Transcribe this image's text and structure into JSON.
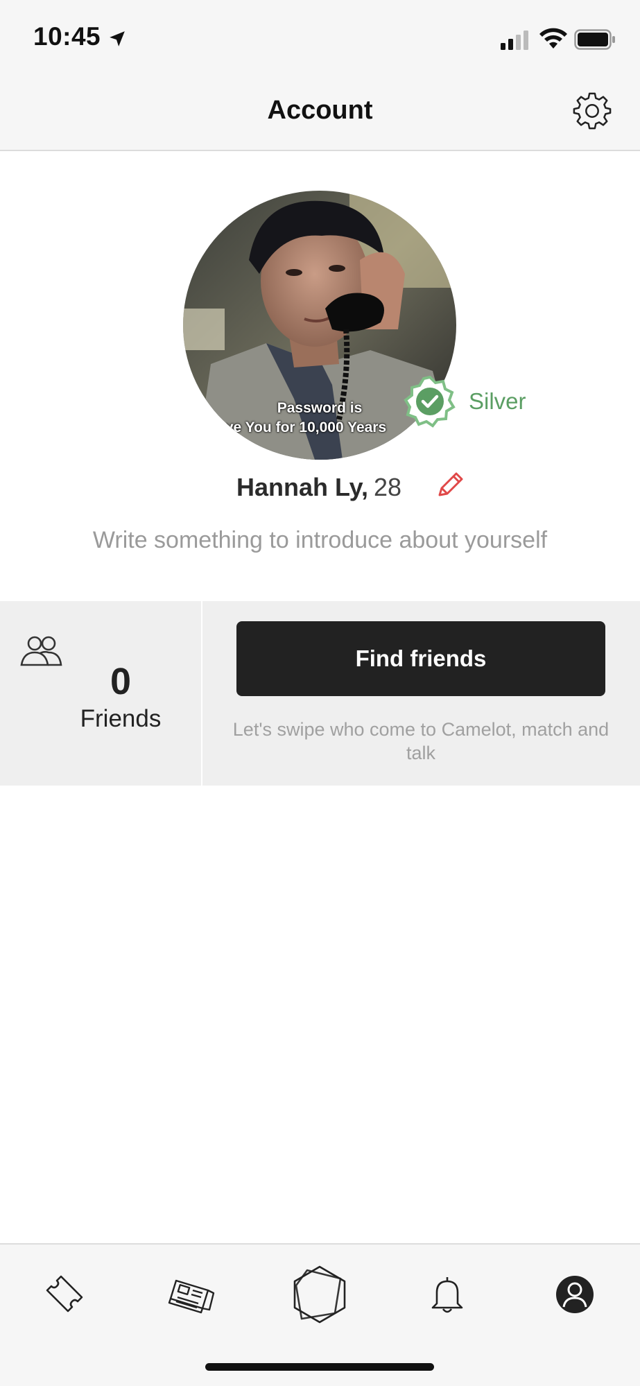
{
  "status_bar": {
    "time": "10:45",
    "icons": [
      "location-arrow-icon",
      "cellular-signal-icon",
      "wifi-icon",
      "battery-icon"
    ]
  },
  "nav": {
    "title": "Account",
    "settings_icon": "gear-icon"
  },
  "profile": {
    "avatar_caption_line1": "Password is",
    "avatar_caption_line2": "ve You for 10,000 Years",
    "badge_icon": "verified-badge-icon",
    "badge_label": "Silver",
    "badge_color": "#5b9e63",
    "name": "Hannah Ly,",
    "age": "28",
    "edit_icon": "pencil-icon",
    "edit_color": "#e04848",
    "bio_placeholder": "Write something to introduce about yourself"
  },
  "friends": {
    "icon": "friends-icon",
    "count": "0",
    "label": "Friends",
    "find_button_label": "Find friends",
    "find_description": "Let's swipe who come to Camelot, match and talk"
  },
  "tab_bar": {
    "tabs": [
      {
        "icon": "ticket-icon"
      },
      {
        "icon": "newspaper-icon"
      },
      {
        "icon": "camelot-hexagon-icon"
      },
      {
        "icon": "bell-icon"
      },
      {
        "icon": "profile-icon",
        "active": true
      }
    ]
  },
  "colors": {
    "accent_dark": "#222222",
    "bar_background": "#f6f6f6",
    "band_background": "#efefef"
  }
}
